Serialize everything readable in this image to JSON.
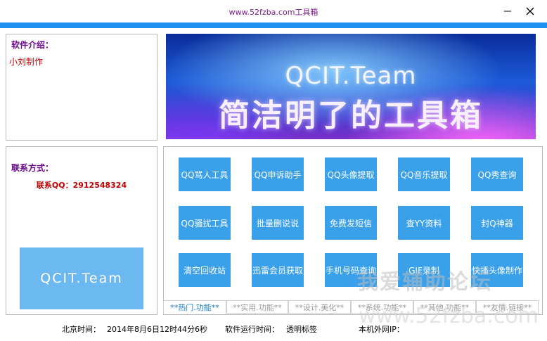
{
  "window": {
    "title": "www.52fzba.com工具箱",
    "minimize_icon": "minimize-icon",
    "close_icon": "close-icon",
    "accent_color": "#1e90f0"
  },
  "intro": {
    "title": "软件介绍：",
    "text": "小刘制作"
  },
  "contact": {
    "title": "联系方式：",
    "qq": "联系QQ：2912548324",
    "logo_text": "QCIT.Team"
  },
  "banner": {
    "line1": "QCIT.Team",
    "line2": "简洁明了的工具箱"
  },
  "tools": [
    "QQ骂人工具",
    "QQ申诉助手",
    "QQ头像提取",
    "QQ音乐提取",
    "QQ秀查询",
    "QQ骚扰工具",
    "批量删说说",
    "免费发短信",
    "查YY资料",
    "封Q神器",
    "清空回收站",
    "迅雷会员获取",
    "手机号码查询",
    "GIF录制",
    "快播头像制作"
  ],
  "tabs": [
    {
      "label": "**热门.功能**",
      "active": true
    },
    {
      "label": "**实用.功能**",
      "active": false
    },
    {
      "label": "**设计.美化**",
      "active": false
    },
    {
      "label": "**系统.功能**",
      "active": false
    },
    {
      "label": "**其他.功能**",
      "active": false
    },
    {
      "label": "**友情.链接**",
      "active": false
    }
  ],
  "watermark": {
    "text": "我爱辅助论坛",
    "url": "www.52fzba.com"
  },
  "status": {
    "time_label": "北京时间：",
    "time_value": "2014年8月6日12时44分6秒",
    "runtime_label": "软件运行时间：",
    "runtime_value": "透明标签",
    "ip_label": "本机外网IP："
  },
  "colors": {
    "button_bg": "#3aa0ea",
    "title_purple": "#6a0a8e",
    "text_red": "#c00000"
  }
}
